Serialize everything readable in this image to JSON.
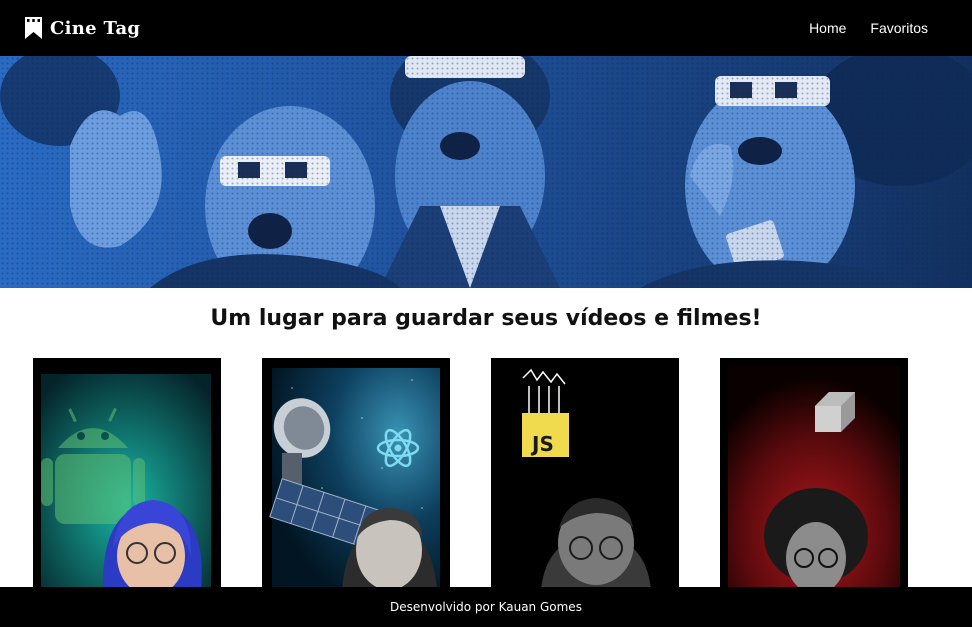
{
  "header": {
    "brand": "Cine Tag",
    "nav": [
      {
        "label": "Home"
      },
      {
        "label": "Favoritos"
      }
    ]
  },
  "main": {
    "title": "Um lugar para guardar seus vídeos e filmes!",
    "cards": [
      {
        "icon": "android-icon",
        "accent": "#1fb8a3"
      },
      {
        "icon": "react-icon",
        "accent": "#61dafb"
      },
      {
        "icon": "javascript-icon",
        "accent": "#f0db4f",
        "badge": "JS"
      },
      {
        "icon": "dart-icon",
        "accent": "#c4161c"
      }
    ]
  },
  "footer": {
    "text": "Desenvolvido por Kauan Gomes"
  },
  "colors": {
    "header_bg": "#000000",
    "banner_blue": "#1e4f98",
    "footer_bg": "#000000"
  }
}
